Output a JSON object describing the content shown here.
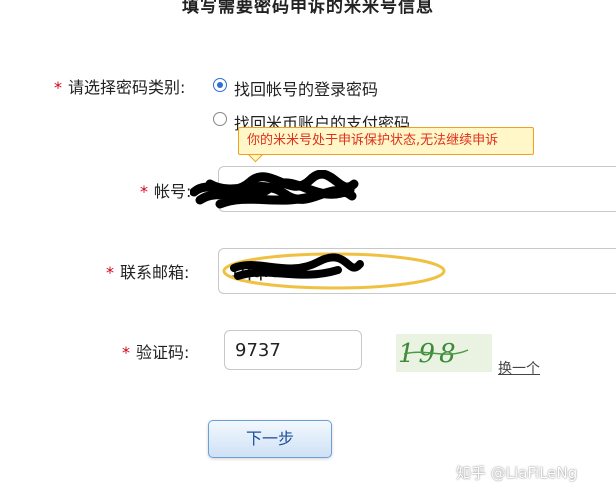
{
  "heading": "填写需要密码申诉的米米号信息",
  "required_marker": "*",
  "password_type": {
    "label": "请选择密码类别:",
    "options": [
      {
        "text": "找回帐号的登录密码",
        "checked": true
      },
      {
        "text": "找回米币账户的支付密码",
        "checked": false
      }
    ]
  },
  "tooltip": "你的米米号处于申诉保护状态,无法继续申诉",
  "account": {
    "label": "帐号:",
    "value": ""
  },
  "email": {
    "label": "联系邮箱:",
    "value": "1qq.com"
  },
  "captcha": {
    "label": "验证码:",
    "value": "9737",
    "image_text": "198",
    "refresh": "换一个"
  },
  "next_button": "下一步",
  "watermark": "知乎 @LiaFiLeNg",
  "colors": {
    "accent": "#2d6fd6",
    "required": "#d0021b",
    "tooltip_border": "#f0a020",
    "tooltip_text": "#e0301e"
  }
}
